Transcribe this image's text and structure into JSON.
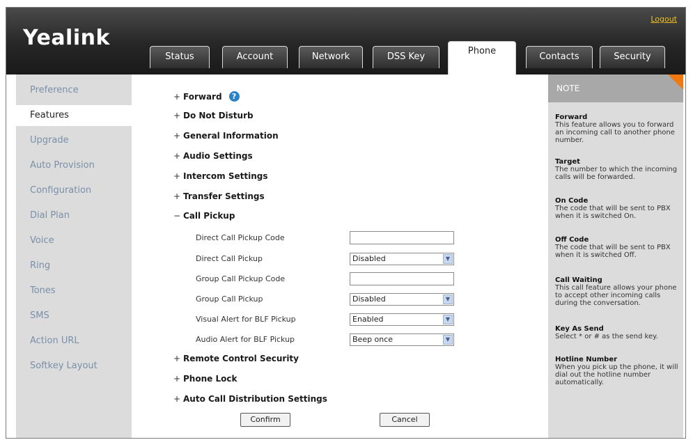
{
  "header": {
    "logo": "Yealink",
    "logout": "Logout"
  },
  "tabs": [
    {
      "label": "Status",
      "active": false
    },
    {
      "label": "Account",
      "active": false
    },
    {
      "label": "Network",
      "active": false
    },
    {
      "label": "DSS Key",
      "active": false
    },
    {
      "label": "Phone",
      "active": true
    },
    {
      "label": "Contacts",
      "active": false
    },
    {
      "label": "Security",
      "active": false
    }
  ],
  "sidebar": {
    "items": [
      {
        "label": "Preference"
      },
      {
        "label": "Features",
        "active": true
      },
      {
        "label": "Upgrade"
      },
      {
        "label": "Auto Provision"
      },
      {
        "label": "Configuration"
      },
      {
        "label": "Dial Plan"
      },
      {
        "label": "Voice"
      },
      {
        "label": "Ring"
      },
      {
        "label": "Tones"
      },
      {
        "label": "SMS"
      },
      {
        "label": "Action URL"
      },
      {
        "label": "Softkey Layout"
      }
    ]
  },
  "sections": {
    "forward": "Forward",
    "dnd": "Do Not Disturb",
    "general": "General Information",
    "audio": "Audio Settings",
    "intercom": "Intercom Settings",
    "transfer": "Transfer Settings",
    "call_pickup": "Call Pickup",
    "remote": "Remote Control Security",
    "phone_lock": "Phone Lock",
    "acd": "Auto Call Distribution Settings"
  },
  "signs": {
    "plus": "+",
    "minus": "−"
  },
  "help_icon": "?",
  "pickup": {
    "direct_code_label": "Direct Call Pickup Code",
    "direct_code_value": "",
    "direct_label": "Direct Call Pickup",
    "direct_value": "Disabled",
    "group_code_label": "Group Call Pickup Code",
    "group_code_value": "",
    "group_label": "Group Call Pickup",
    "group_value": "Disabled",
    "visual_label": "Visual Alert for BLF Pickup",
    "visual_value": "Enabled",
    "audio_label": "Audio Alert for BLF Pickup",
    "audio_value": "Beep once"
  },
  "buttons": {
    "confirm": "Confirm",
    "cancel": "Cancel"
  },
  "note": {
    "title": "NOTE",
    "items": [
      {
        "title": "Forward",
        "text": "This feature allows you to forward an incoming call to another phone number."
      },
      {
        "title": "Target",
        "text": "The number to which the incoming calls will be forwarded."
      },
      {
        "title": "On Code",
        "text": "The code that will be sent to PBX when it is switched On."
      },
      {
        "title": "Off Code",
        "text": "The code that will be sent to PBX when it is switched Off."
      },
      {
        "title": "Call Waiting",
        "text": "This call feature allows your phone to accept other incoming calls during the conversation."
      },
      {
        "title": "Key As Send",
        "text": "Select * or # as the send key."
      },
      {
        "title": "Hotline Number",
        "text": "When you pick up the phone, it will dial out the hotline number automatically."
      }
    ]
  }
}
